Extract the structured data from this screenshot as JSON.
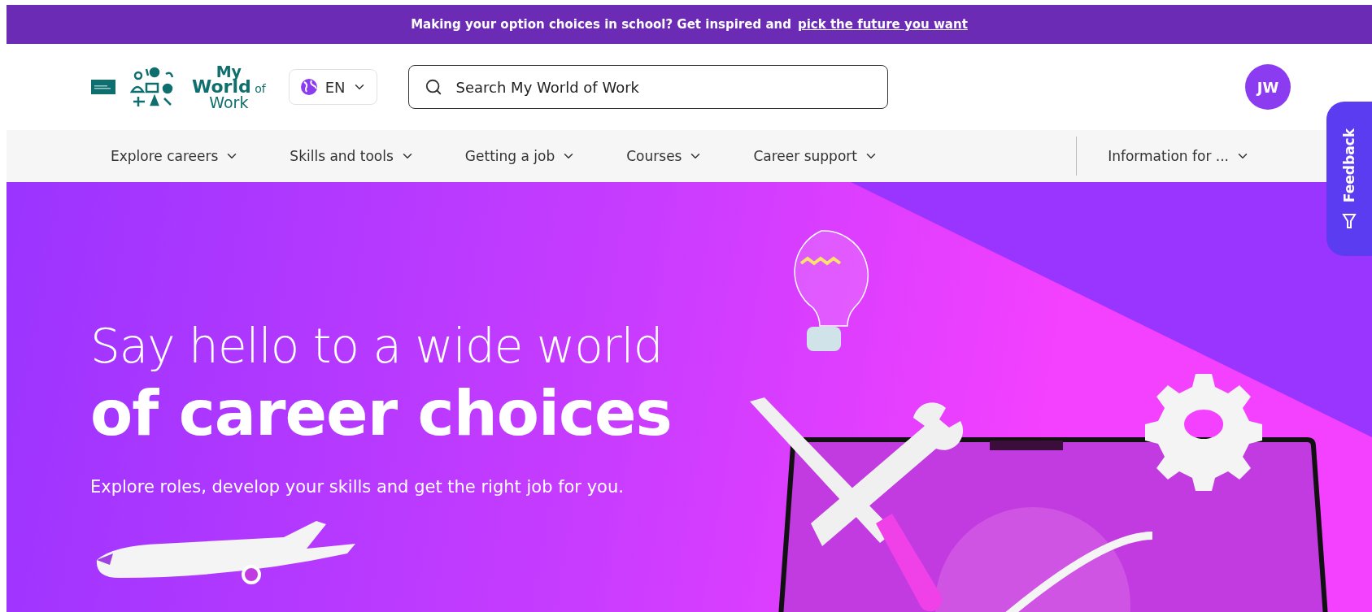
{
  "banner": {
    "text": "Making your option choices in school? Get inspired and",
    "link": "pick the future you want"
  },
  "header": {
    "logo": {
      "line1": "My",
      "line2": "World",
      "suffix": "of",
      "line3": "Work"
    },
    "language": "EN",
    "search": {
      "placeholder": "Search My World of Work"
    },
    "avatar": "JW"
  },
  "nav": {
    "items": [
      {
        "label": "Explore careers"
      },
      {
        "label": "Skills and tools"
      },
      {
        "label": "Getting a job"
      },
      {
        "label": "Courses"
      },
      {
        "label": "Career support"
      }
    ],
    "info": {
      "label": "Information for ..."
    }
  },
  "feedback": {
    "label": "Feedback"
  },
  "hero": {
    "title_line1": "Say hello to a wide world",
    "title_line2": "of career choices",
    "subtitle": "Explore roles, develop your skills and get the right job for you."
  }
}
